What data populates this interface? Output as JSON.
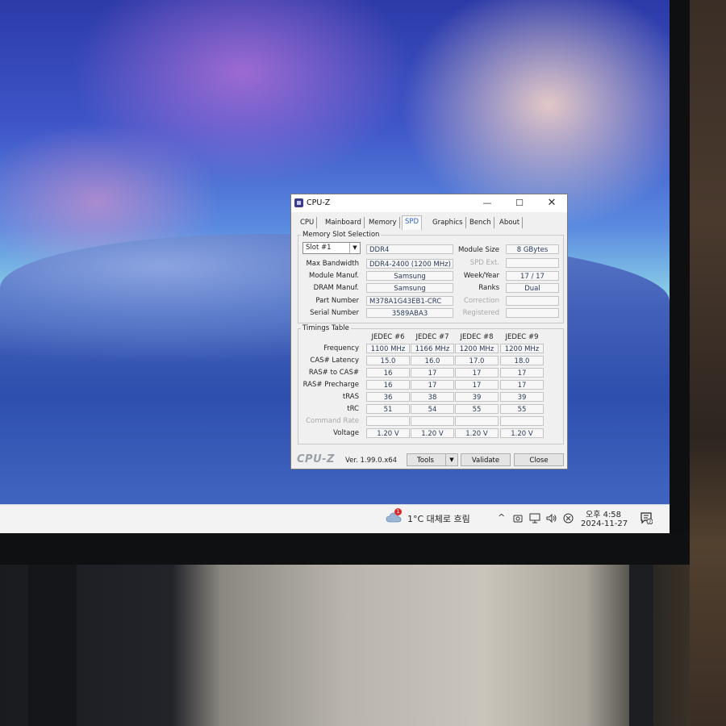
{
  "window": {
    "title": "CPU-Z",
    "controls": {
      "minimize": "—",
      "maximize": "☐",
      "close": "✕"
    }
  },
  "tabs": [
    {
      "label": "CPU",
      "active": false
    },
    {
      "label": "Mainboard",
      "active": false
    },
    {
      "label": "Memory",
      "active": false
    },
    {
      "label": "SPD",
      "active": true
    },
    {
      "label": "Graphics",
      "active": false
    },
    {
      "label": "Bench",
      "active": false
    },
    {
      "label": "About",
      "active": false
    }
  ],
  "memory_slot": {
    "group_title": "Memory Slot Selection",
    "slot_selected": "Slot #1",
    "type": "DDR4",
    "labels": {
      "max_bandwidth": "Max Bandwidth",
      "module_manuf": "Module Manuf.",
      "dram_manuf": "DRAM Manuf.",
      "part_number": "Part Number",
      "serial_number": "Serial Number",
      "module_size": "Module Size",
      "spd_ext": "SPD Ext.",
      "week_year": "Week/Year",
      "ranks": "Ranks",
      "correction": "Correction",
      "registered": "Registered"
    },
    "values": {
      "max_bandwidth": "DDR4-2400 (1200 MHz)",
      "module_manuf": "Samsung",
      "dram_manuf": "Samsung",
      "part_number": "M378A1G43EB1-CRC",
      "serial_number": "3589ABA3",
      "module_size": "8 GBytes",
      "spd_ext": "",
      "week_year": "17 / 17",
      "ranks": "Dual",
      "correction": "",
      "registered": ""
    }
  },
  "timings": {
    "group_title": "Timings Table",
    "columns": [
      "JEDEC #6",
      "JEDEC #7",
      "JEDEC #8",
      "JEDEC #9"
    ],
    "rows": [
      {
        "label": "Frequency",
        "values": [
          "1100 MHz",
          "1166 MHz",
          "1200 MHz",
          "1200 MHz"
        ]
      },
      {
        "label": "CAS# Latency",
        "values": [
          "15.0",
          "16.0",
          "17.0",
          "18.0"
        ]
      },
      {
        "label": "RAS# to CAS#",
        "values": [
          "16",
          "17",
          "17",
          "17"
        ]
      },
      {
        "label": "RAS# Precharge",
        "values": [
          "16",
          "17",
          "17",
          "17"
        ]
      },
      {
        "label": "tRAS",
        "values": [
          "36",
          "38",
          "39",
          "39"
        ]
      },
      {
        "label": "tRC",
        "values": [
          "51",
          "54",
          "55",
          "55"
        ]
      },
      {
        "label": "Command Rate",
        "values": [
          "",
          "",
          "",
          ""
        ],
        "dim": true
      },
      {
        "label": "Voltage",
        "values": [
          "1.20 V",
          "1.20 V",
          "1.20 V",
          "1.20 V"
        ]
      }
    ]
  },
  "footer": {
    "brand": "CPU-Z",
    "version": "Ver. 1.99.0.x64",
    "tools": "Tools",
    "validate": "Validate",
    "close": "Close"
  },
  "taskbar": {
    "weather_badge": "1",
    "weather_text": "1°C  대체로 흐림",
    "time": "오후 4:58",
    "date": "2024-11-27",
    "notification_badge": "2"
  }
}
